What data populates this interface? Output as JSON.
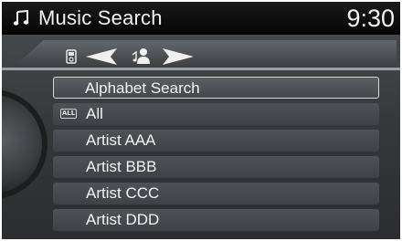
{
  "header": {
    "title": "Music Search",
    "time": "9:30",
    "icon": "music-note-icon"
  },
  "tabs": {
    "left_icon": "media-device-icon",
    "center_icon": "artist-icon",
    "arrows": [
      "left-arrow-icon",
      "right-arrow-icon"
    ]
  },
  "list": {
    "alphabet_search": "Alphabet Search",
    "all_badge": "ALL",
    "all": "All",
    "items": [
      "Artist AAA",
      "Artist BBB",
      "Artist CCC",
      "Artist DDD"
    ]
  },
  "colors": {
    "selection_outline": "#d8d8d8",
    "text": "#f4f4f4"
  }
}
